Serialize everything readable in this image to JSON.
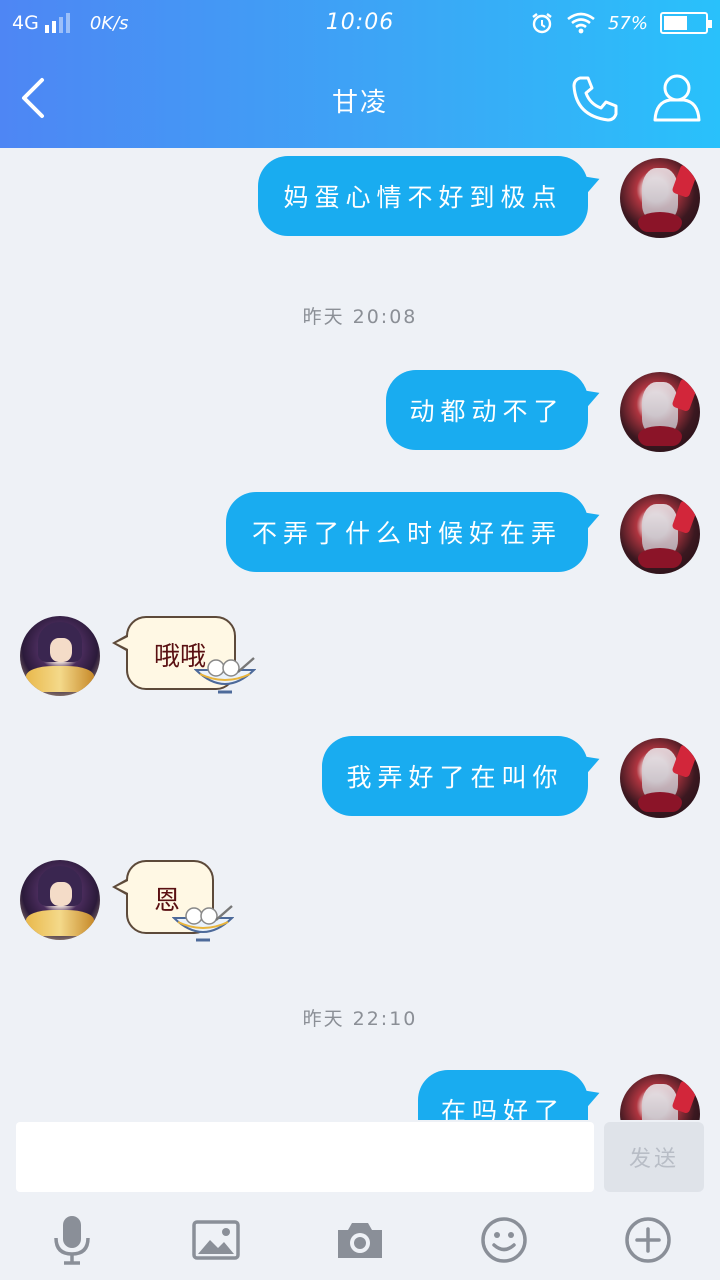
{
  "status_bar": {
    "network": "4G",
    "speed": "0K/s",
    "time": "10:06",
    "battery": "57%",
    "battery_level": 0.57
  },
  "header": {
    "title": "甘凌"
  },
  "messages": [
    {
      "type": "text",
      "side": "right",
      "text": "妈蛋心情不好到极点"
    },
    {
      "type": "timestamp",
      "text": "昨天 20:08"
    },
    {
      "type": "text",
      "side": "right",
      "text": "动都动不了"
    },
    {
      "type": "text",
      "side": "right",
      "text": "不弄了什么时候好在弄"
    },
    {
      "type": "sticker",
      "side": "left",
      "text": "哦哦"
    },
    {
      "type": "text",
      "side": "right",
      "text": "我弄好了在叫你"
    },
    {
      "type": "sticker",
      "side": "left",
      "text": "恩"
    },
    {
      "type": "timestamp",
      "text": "昨天 22:10"
    },
    {
      "type": "text",
      "side": "right",
      "text": "在吗好了"
    }
  ],
  "input": {
    "value": "",
    "send_label": "发送"
  },
  "toolbar": {
    "icons": [
      "microphone-icon",
      "image-icon",
      "camera-icon",
      "emoji-icon",
      "plus-icon"
    ]
  },
  "colors": {
    "header_start": "#4e86f4",
    "header_end": "#29c1fb",
    "bubble": "#19acf0",
    "background": "#eef1f6"
  }
}
